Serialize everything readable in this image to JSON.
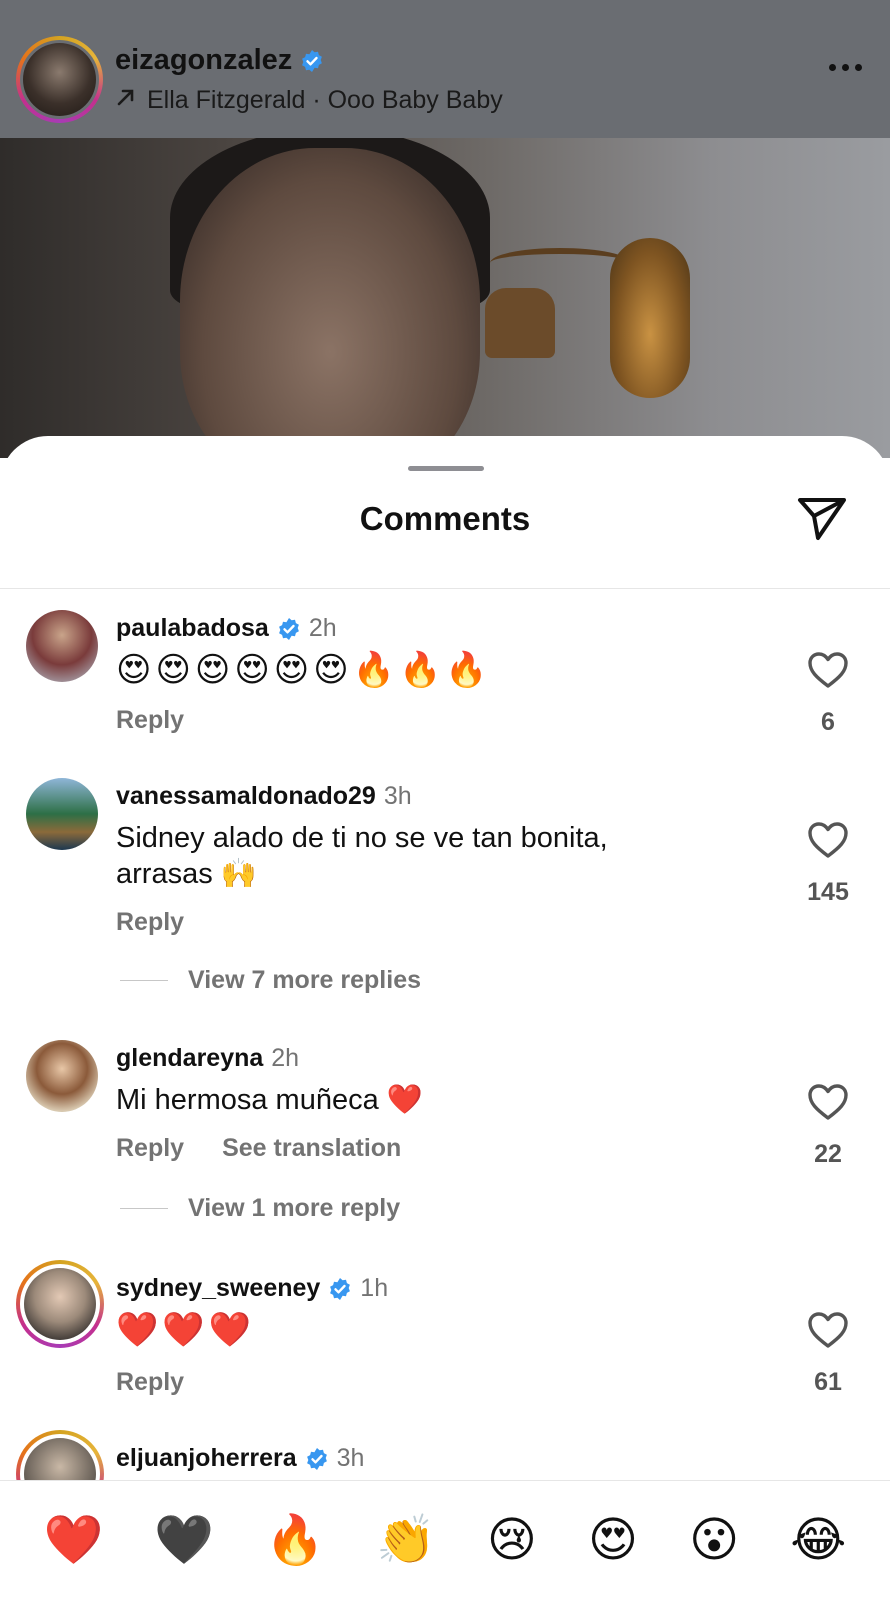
{
  "post": {
    "username": "eizagonzalez",
    "music": "Ella Fitzgerald · Ooo Baby Baby"
  },
  "sheet": {
    "title": "Comments"
  },
  "comments": [
    {
      "username": "paulabadosa",
      "verified": true,
      "time": "2h",
      "text": "😍😍😍😍😍😍🔥🔥🔥",
      "reply_label": "Reply",
      "likes": "6"
    },
    {
      "username": "vanessamaldonado29",
      "verified": false,
      "time": "3h",
      "text": "Sidney alado de ti no se ve tan bonita, arrasas 🙌",
      "reply_label": "Reply",
      "likes": "145",
      "view_replies": "View 7 more replies"
    },
    {
      "username": "glendareyna",
      "verified": false,
      "time": "2h",
      "text": "Mi hermosa muñeca ❤️",
      "reply_label": "Reply",
      "translate_label": "See translation",
      "likes": "22",
      "view_replies": "View 1 more reply"
    },
    {
      "username": "sydney_sweeney",
      "verified": true,
      "time": "1h",
      "text": "❤️❤️❤️",
      "reply_label": "Reply",
      "likes": "61"
    },
    {
      "username": "eljuanjoherrera",
      "verified": true,
      "time": "3h"
    }
  ],
  "reactions": [
    "❤️",
    "🖤",
    "🔥",
    "👏",
    "😢",
    "😍",
    "😮",
    "😂"
  ],
  "colors": {
    "verified": "#3897f0",
    "secondary_text": "#737373",
    "story_ring": [
      "#d4a321",
      "#c42f8e",
      "#a83bb5"
    ]
  },
  "icons": {
    "share": "paper-plane-icon",
    "like": "heart-outline-icon",
    "music": "arrow-up-right-icon",
    "more": "more-horizontal-icon"
  }
}
